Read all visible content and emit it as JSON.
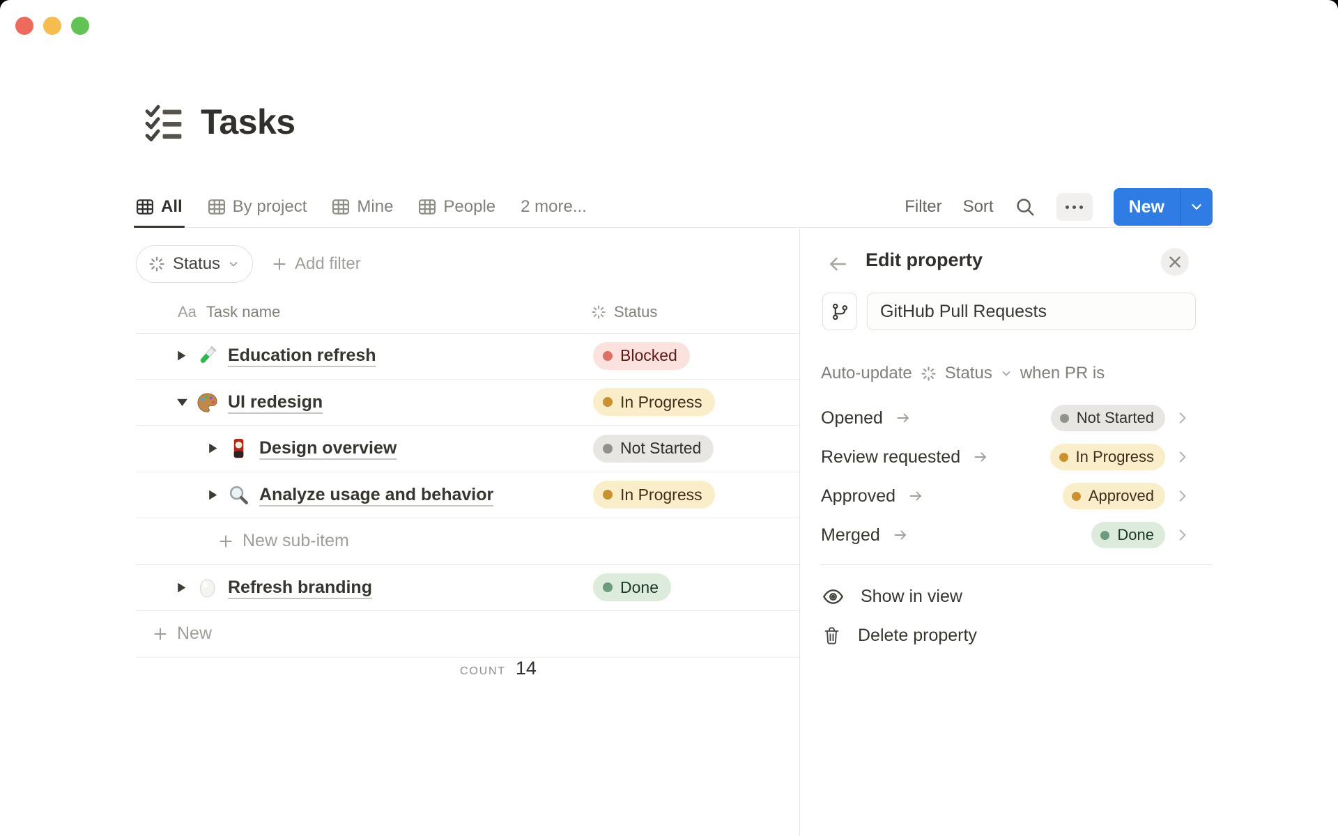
{
  "window": {
    "traffic_lights": {
      "close": "#ee6a5f",
      "minimize": "#f5bd4f",
      "zoom": "#61c354"
    }
  },
  "page": {
    "title": "Tasks",
    "icon": "checklist-icon"
  },
  "tabs": {
    "items": [
      {
        "label": "All",
        "icon": "table-icon",
        "active": true
      },
      {
        "label": "By project",
        "icon": "table-icon",
        "active": false
      },
      {
        "label": "Mine",
        "icon": "table-icon",
        "active": false
      },
      {
        "label": "People",
        "icon": "table-icon",
        "active": false
      }
    ],
    "more": "2 more..."
  },
  "toolbar": {
    "filter": "Filter",
    "sort": "Sort",
    "search_icon": "search-icon",
    "more_icon": "ellipsis-icon",
    "new": "New",
    "accent": "#2e7ce4"
  },
  "filter_bar": {
    "status_chip": "Status",
    "status_icon": "status-spinner-icon",
    "add_filter": "Add filter"
  },
  "table": {
    "header": {
      "name_prefix": "Aa",
      "name": "Task name",
      "status": "Status",
      "status_icon": "status-spinner-icon"
    },
    "rows": [
      {
        "title": "Education refresh",
        "icon": "test-tube",
        "level": 0,
        "toggle": "collapsed",
        "status": "Blocked",
        "status_color": "red"
      },
      {
        "title": "UI redesign",
        "icon": "palette",
        "level": 0,
        "toggle": "expanded",
        "status": "In Progress",
        "status_color": "yellow"
      },
      {
        "title": "Design overview",
        "icon": "flower-card",
        "level": 1,
        "toggle": "collapsed",
        "status": "Not Started",
        "status_color": "gray"
      },
      {
        "title": "Analyze usage and behavior",
        "icon": "magnifying-glass",
        "level": 1,
        "toggle": "collapsed",
        "status": "In Progress",
        "status_color": "yellow"
      },
      {
        "title": "Refresh branding",
        "icon": "egg",
        "level": 0,
        "toggle": "collapsed",
        "status": "Done",
        "status_color": "green"
      }
    ],
    "new_sub_item": "New sub-item",
    "new_row": "New",
    "count_label": "COUNT",
    "count_value": "14"
  },
  "panel": {
    "title": "Edit property",
    "back_icon": "arrow-left-icon",
    "close_icon": "close-icon",
    "property_icon": "git-branch-icon",
    "property_value": "GitHub Pull Requests",
    "auto_update": {
      "prefix": "Auto-update",
      "status_icon": "status-spinner-icon",
      "status": "Status",
      "suffix": "when PR is"
    },
    "mappings": [
      {
        "event": "Opened",
        "status": "Not Started",
        "status_color": "gray"
      },
      {
        "event": "Review requested",
        "status": "In Progress",
        "status_color": "yellow"
      },
      {
        "event": "Approved",
        "status": "Approved",
        "status_color": "yellow"
      },
      {
        "event": "Merged",
        "status": "Done",
        "status_color": "green"
      }
    ],
    "actions": [
      {
        "label": "Show in view",
        "icon": "eye-icon"
      },
      {
        "label": "Delete property",
        "icon": "trash-icon"
      }
    ]
  },
  "status_colors": {
    "gray": {
      "bg": "#e7e6e3",
      "dot": "#91918e",
      "text": "#32302c"
    },
    "yellow": {
      "bg": "#faeeca",
      "dot": "#c9912f",
      "text": "#402c1b"
    },
    "red": {
      "bg": "#fbe2de",
      "dot": "#dd7066",
      "text": "#5d1715"
    },
    "green": {
      "bg": "#dcebdc",
      "dot": "#6c9b7d",
      "text": "#1c3829"
    }
  }
}
